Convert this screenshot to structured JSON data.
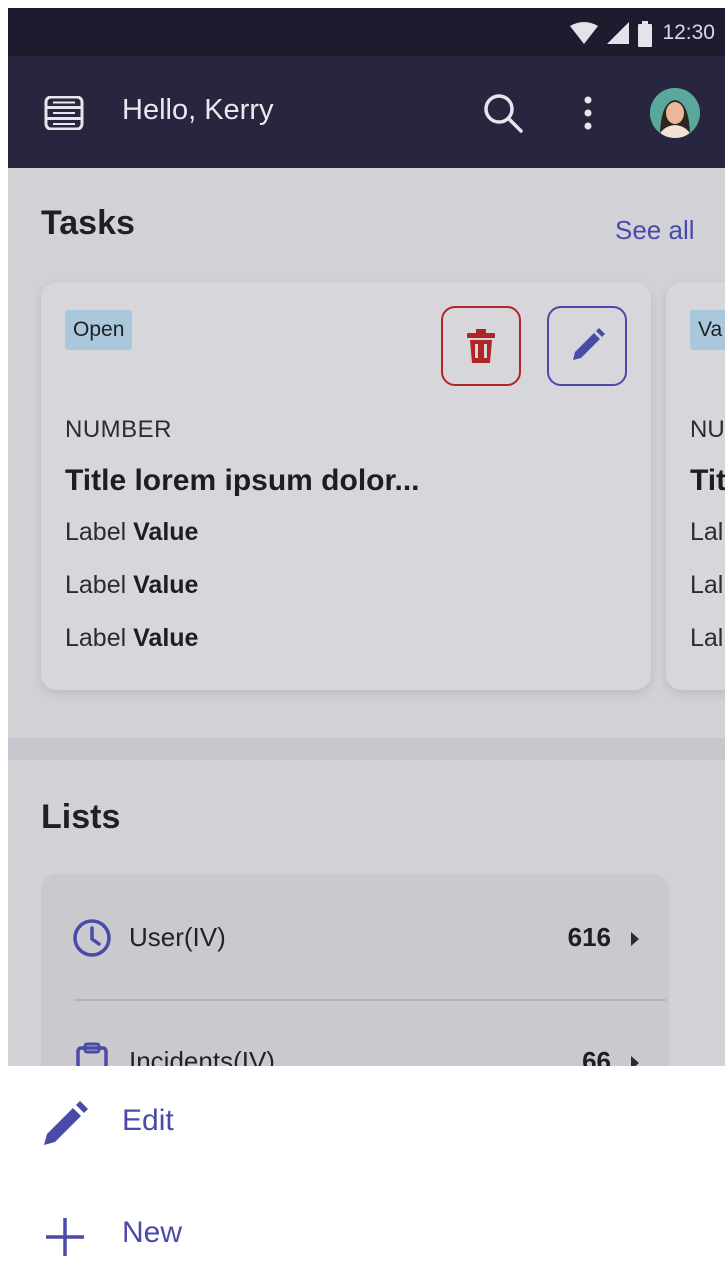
{
  "status_bar": {
    "time": "12:30"
  },
  "app_bar": {
    "greeting": "Hello, Kerry"
  },
  "tasks": {
    "title": "Tasks",
    "see_all": "See all",
    "cards": [
      {
        "status": "Open",
        "number": "NUMBER",
        "title": "Title lorem ipsum dolor...",
        "rows": [
          {
            "label": "Label",
            "value": "Value"
          },
          {
            "label": "Label",
            "value": "Value"
          },
          {
            "label": "Label",
            "value": "Value"
          }
        ]
      },
      {
        "status_partial": "Va",
        "number_partial": "NU",
        "title_partial": "Tit",
        "rows_partial": [
          "Lal",
          "Lal",
          "Lal"
        ]
      }
    ]
  },
  "lists": {
    "title": "Lists",
    "items": [
      {
        "label": "User(IV)",
        "count": "616",
        "icon": "clock-icon"
      },
      {
        "label": "Incidents(IV)",
        "count": "66",
        "icon": "clipboard-icon"
      }
    ]
  },
  "bottom_sheet": {
    "items": [
      {
        "label": "Edit",
        "icon": "pencil-icon"
      },
      {
        "label": "New",
        "icon": "plus-icon"
      }
    ]
  },
  "colors": {
    "app_bar": "#27263e",
    "accent": "#4a4aa8",
    "danger": "#b02626",
    "badge": "#a9c8dc",
    "background": "#d1d1d6"
  }
}
